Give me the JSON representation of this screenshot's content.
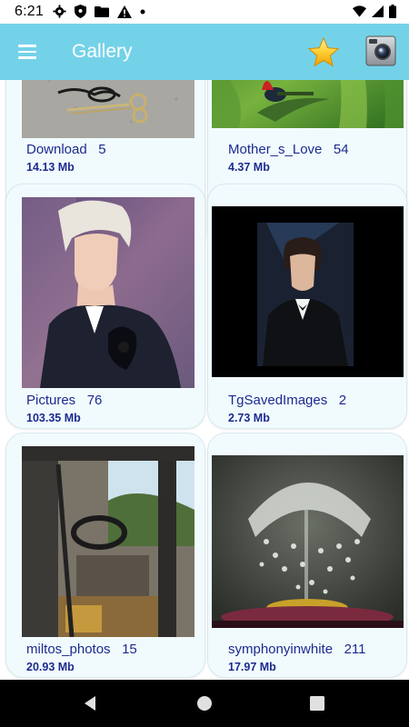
{
  "status_bar": {
    "time": "6:21",
    "icons_left": [
      "gear-icon",
      "shield-icon",
      "folder-icon",
      "warning-icon",
      "dot-icon"
    ],
    "icons_right": [
      "wifi-icon",
      "signal-icon",
      "battery-icon"
    ]
  },
  "app_bar": {
    "title": "Gallery",
    "background": "#74d2e8",
    "actions": [
      "star-icon",
      "camera-icon"
    ]
  },
  "albums": [
    {
      "name": "Download",
      "count": "5",
      "size": "14.13 Mb"
    },
    {
      "name": "Mother_s_Love",
      "count": "54",
      "size": "4.37 Mb"
    },
    {
      "name": "Pictures",
      "count": "76",
      "size": "103.35 Mb"
    },
    {
      "name": "TgSavedImages",
      "count": "2",
      "size": "2.73 Mb"
    },
    {
      "name": "miltos_photos",
      "count": "15",
      "size": "20.93 Mb"
    },
    {
      "name": "symphonyinwhite",
      "count": "211",
      "size": "17.97 Mb"
    }
  ],
  "nav_bar": {
    "buttons": [
      "back-icon",
      "home-icon",
      "recents-icon"
    ]
  },
  "colors": {
    "accent": "#74d2e8",
    "card_background": "#f1fbfe",
    "label_text": "#1c2a8f"
  }
}
